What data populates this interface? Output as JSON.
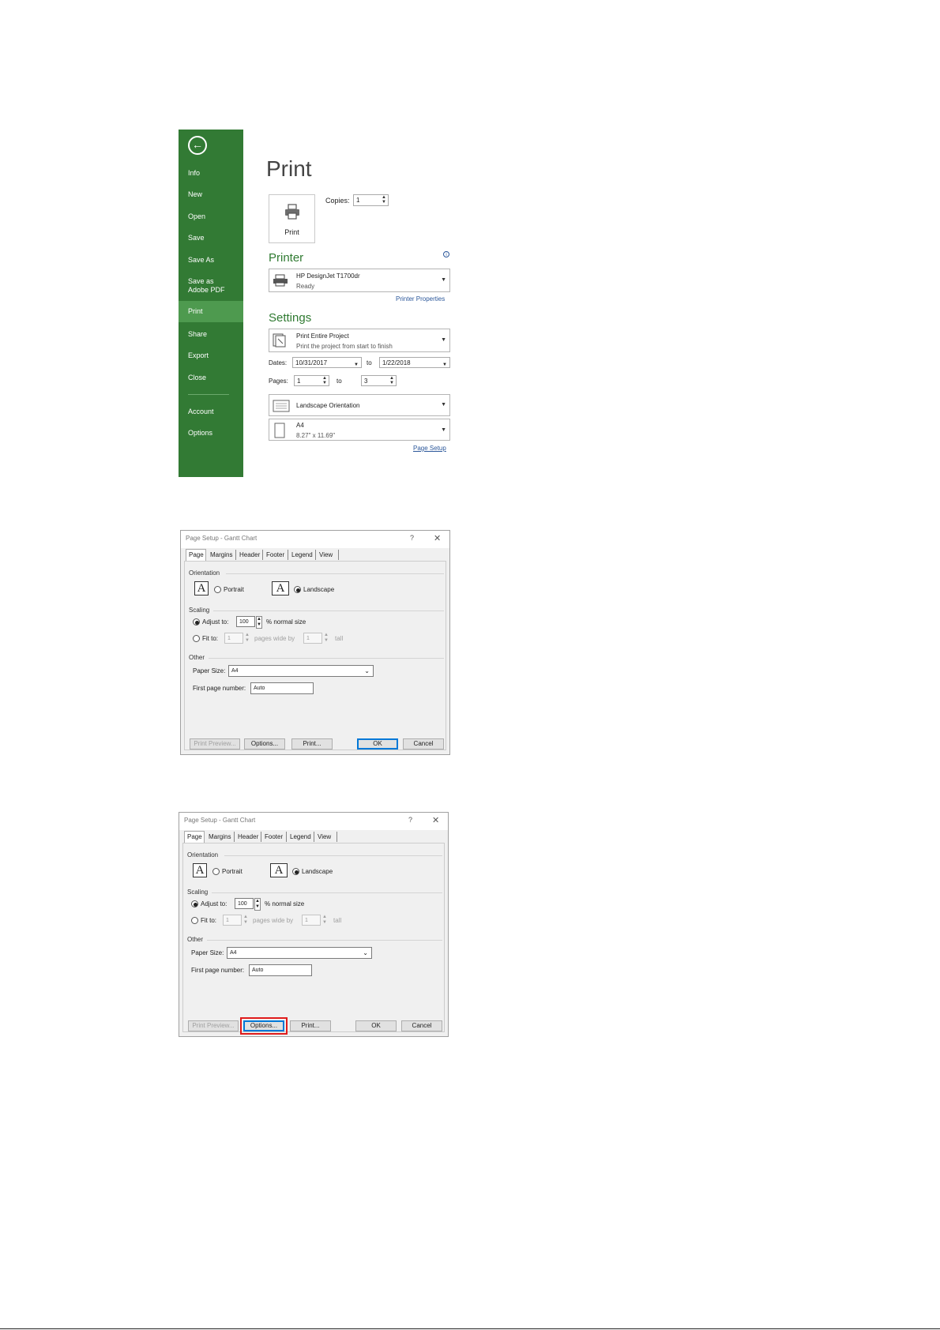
{
  "backstage": {
    "nav": {
      "items": [
        "Info",
        "New",
        "Open",
        "Save",
        "Save As",
        "Save as Adobe PDF",
        "Print",
        "Share",
        "Export",
        "Close",
        "Account",
        "Options"
      ],
      "selected": "Print"
    },
    "title": "Print",
    "print_button": "Print",
    "copies_label": "Copies:",
    "copies_value": "1",
    "printer_heading": "Printer",
    "printer_name": "HP DesignJet T1700dr",
    "printer_status": "Ready",
    "printer_properties": "Printer Properties",
    "settings_heading": "Settings",
    "scope_title": "Print Entire Project",
    "scope_desc": "Print the project from start to finish",
    "dates_label": "Dates:",
    "date_from": "10/31/2017",
    "to_label": "to",
    "date_to": "1/22/2018",
    "pages_label": "Pages:",
    "page_from": "1",
    "page_to": "3",
    "orientation": "Landscape Orientation",
    "paper_name": "A4",
    "paper_size": "8.27\" x 11.69\"",
    "page_setup_link": "Page Setup"
  },
  "dialog": {
    "title": "Page Setup - Gantt Chart",
    "help": "?",
    "close": "✕",
    "tabs": [
      "Page",
      "Margins",
      "Header",
      "Footer",
      "Legend",
      "View"
    ],
    "orientation_group": "Orientation",
    "portrait": "Portrait",
    "landscape": "Landscape",
    "scaling_group": "Scaling",
    "adjust_to": "Adjust to:",
    "adjust_value": "100",
    "normal_size": "% normal size",
    "fit_to": "Fit to:",
    "fit_wide": "1",
    "pages_wide_by": "pages wide by",
    "fit_tall": "1",
    "tall": "tall",
    "other_group": "Other",
    "paper_size_label": "Paper Size:",
    "paper_size_value": "A4",
    "first_page_label": "First page number:",
    "first_page_value": "Auto",
    "buttons": {
      "print_preview": "Print Preview...",
      "options": "Options...",
      "print": "Print...",
      "ok": "OK",
      "cancel": "Cancel"
    }
  },
  "colors": {
    "nav_green": "#327a34",
    "nav_selected": "#4e9a4f",
    "heading_green": "#2f7a31",
    "link_blue": "#2b579a",
    "highlight_red": "#e01b1b"
  }
}
